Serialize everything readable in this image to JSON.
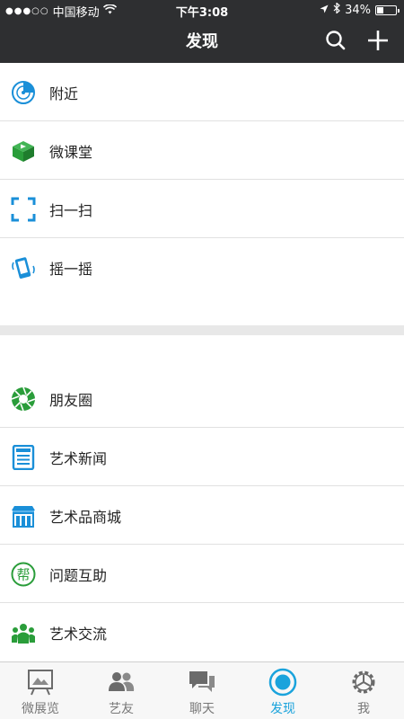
{
  "status_bar": {
    "signal": "●●●○○",
    "carrier": "中国移动",
    "time": "下午3:08",
    "battery_text": "34%",
    "battery_level": 0.34
  },
  "nav": {
    "title": "发现",
    "search_icon": "search-icon",
    "plus_icon": "plus-icon"
  },
  "menu": {
    "group1": [
      {
        "label": "附近",
        "icon": "radar-icon",
        "color": "#1a8fd8"
      },
      {
        "label": "微课堂",
        "icon": "play-box-icon",
        "color": "#2a9d3a"
      },
      {
        "label": "扫一扫",
        "icon": "scan-icon",
        "color": "#1a8fd8"
      },
      {
        "label": "摇一摇",
        "icon": "shake-phone-icon",
        "color": "#1a8fd8"
      }
    ],
    "group2": [
      {
        "label": "朋友圈",
        "icon": "aperture-icon",
        "color": "#2a9d3a"
      },
      {
        "label": "艺术新闻",
        "icon": "news-icon",
        "color": "#1a8fd8"
      },
      {
        "label": "艺术品商城",
        "icon": "store-icon",
        "color": "#1a8fd8"
      },
      {
        "label": "问题互助",
        "icon": "help-badge-icon",
        "color": "#2a9d3a",
        "badge_text": "帮"
      },
      {
        "label": "艺术交流",
        "icon": "people-icon",
        "color": "#2a9d3a"
      }
    ]
  },
  "tabs": [
    {
      "label": "微展览",
      "icon": "easel-icon",
      "active": false
    },
    {
      "label": "艺友",
      "icon": "friends-icon",
      "active": false
    },
    {
      "label": "聊天",
      "icon": "chat-icon",
      "active": false
    },
    {
      "label": "发现",
      "icon": "discover-icon",
      "active": true
    },
    {
      "label": "我",
      "icon": "gear-icon",
      "active": false
    }
  ],
  "colors": {
    "header_bg": "#2e2f31",
    "accent": "#1aa3dc",
    "blue": "#1a8fd8",
    "green": "#2a9d3a"
  }
}
